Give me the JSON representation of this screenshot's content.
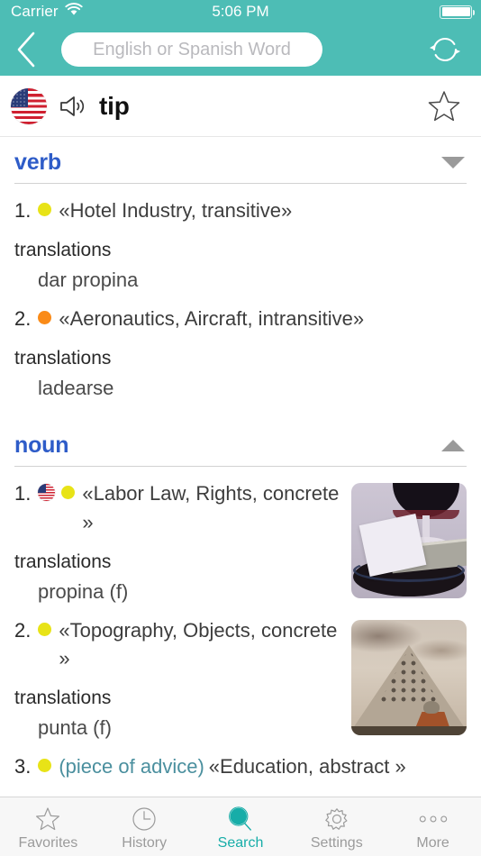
{
  "status_bar": {
    "carrier": "Carrier",
    "wifi_icon": "wifi-icon",
    "time": "5:06 PM",
    "battery_icon": "battery-full-icon"
  },
  "nav_bar": {
    "back_icon": "chevron-left-icon",
    "search_placeholder": "English or Spanish Word",
    "search_value": "",
    "swap_icon": "swap-languages-icon",
    "accent_color": "#4DBDB5"
  },
  "word_header": {
    "flag_icon": "us-flag-icon",
    "speaker_icon": "speaker-icon",
    "headword": "tip",
    "favorite_icon": "star-outline-icon"
  },
  "sections": [
    {
      "pos": "verb",
      "toggle_icon": "triangle-down-icon",
      "expanded": true,
      "senses": [
        {
          "num": "1.",
          "flag": false,
          "dot_color": "#E8E317",
          "gloss": "",
          "tags": "«Hotel Industry, transitive»",
          "translations_label": "translations",
          "translations": [
            "dar propina"
          ],
          "image": null
        },
        {
          "num": "2.",
          "flag": false,
          "dot_color": "#FA8B18",
          "gloss": "",
          "tags": "«Aeronautics, Aircraft, intransitive»",
          "translations_label": "translations",
          "translations": [
            "ladearse"
          ],
          "image": null
        }
      ]
    },
    {
      "pos": "noun",
      "toggle_icon": "triangle-up-icon",
      "expanded": true,
      "senses": [
        {
          "num": "1.",
          "flag": true,
          "dot_color": "#E8E317",
          "gloss": "",
          "tags": "«Labor Law, Rights, concrete »",
          "translations_label": "translations",
          "translations": [
            "propina (f)"
          ],
          "image": "wine-glass-tip-thumbnail"
        },
        {
          "num": "2.",
          "flag": false,
          "dot_color": "#E8E317",
          "gloss": "",
          "tags": "«Topography, Objects, concrete »",
          "translations_label": "translations",
          "translations": [
            "punta (f)"
          ],
          "image": "pyramid-thumbnail"
        },
        {
          "num": "3.",
          "flag": false,
          "dot_color": "#E8E317",
          "gloss": "(piece of advice)",
          "tags": "«Education, abstract »",
          "translations_label": "",
          "translations": [],
          "image": null
        }
      ]
    }
  ],
  "tab_bar": {
    "active_color": "#17ADA8",
    "items": [
      {
        "label": "Favorites",
        "icon": "star-icon",
        "active": false
      },
      {
        "label": "History",
        "icon": "clock-icon",
        "active": false
      },
      {
        "label": "Search",
        "icon": "magnifier-icon",
        "active": true
      },
      {
        "label": "Settings",
        "icon": "gear-icon",
        "active": false
      },
      {
        "label": "More",
        "icon": "ellipsis-icon",
        "active": false
      }
    ]
  }
}
